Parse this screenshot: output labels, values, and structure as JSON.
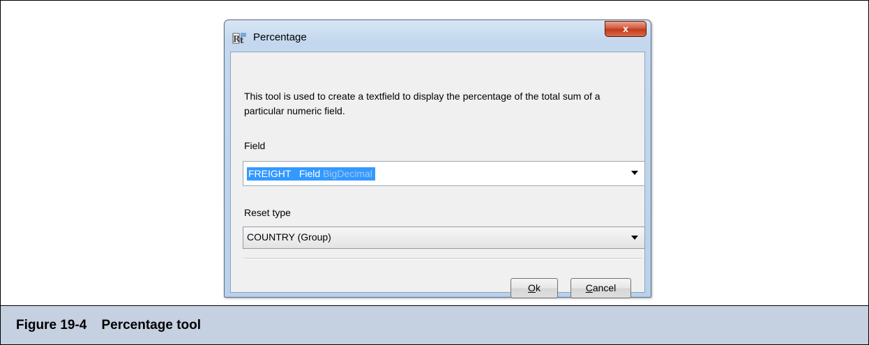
{
  "dialog": {
    "title": "Percentage",
    "close_label": "x",
    "description": "This tool is used to create a textfield to display the percentage of the total sum of a particular numeric field.",
    "field_label": "Field",
    "field_value_main": "FREIGHT   Field ",
    "field_value_type": "BigDecimal",
    "reset_label": "Reset type",
    "reset_value": "COUNTRY (Group)",
    "ok_mnemonic": "O",
    "ok_rest": "k",
    "cancel_mnemonic": "C",
    "cancel_rest": "ancel"
  },
  "caption": {
    "text": "Figure 19-4    Percentage tool"
  },
  "colors": {
    "caption_bar": "#c5d0e0",
    "selection": "#3399ff",
    "window_frame": "#b9d1ea"
  },
  "icons": {
    "app": "jasper-report-icon",
    "close": "close-icon",
    "dropdown": "chevron-down-icon"
  }
}
